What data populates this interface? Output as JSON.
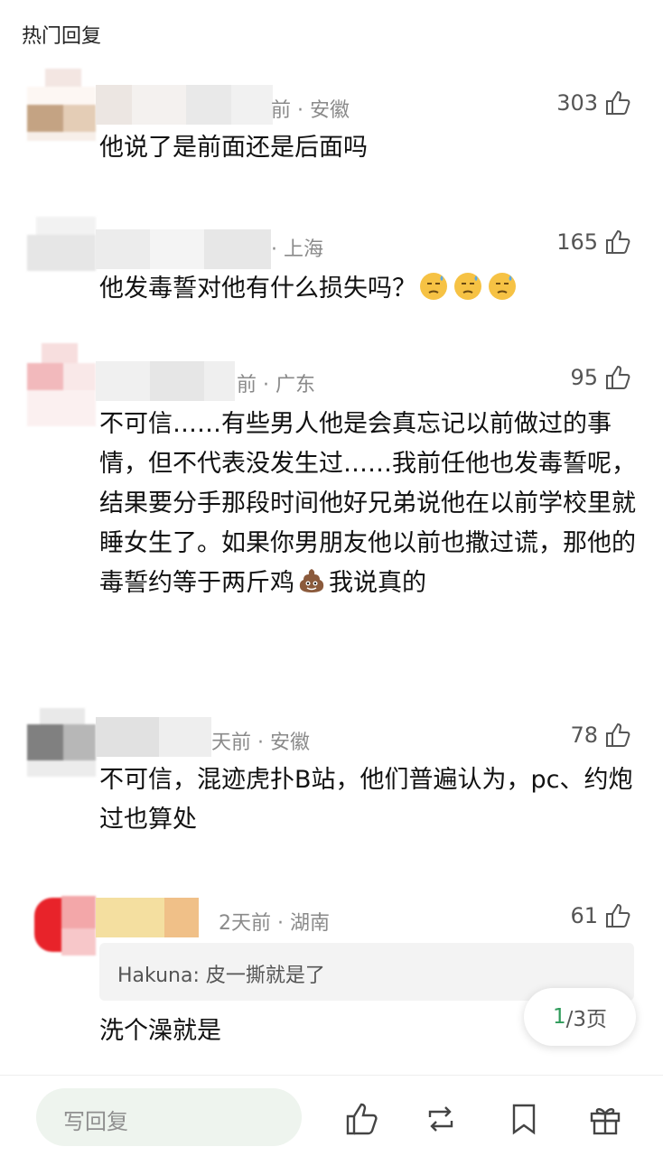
{
  "header": {
    "title": "热门回复"
  },
  "colors": {
    "accent": "#2e9b5a",
    "meta": "#8a8a8a"
  },
  "comments": [
    {
      "meta": "前 · 安徽",
      "likes": "303",
      "text": "他说了是前面还是后面吗"
    },
    {
      "meta": "· 上海",
      "likes": "165",
      "text": "他发毒誓对他有什么损失吗？"
    },
    {
      "meta": "前 · 广东",
      "likes": "95",
      "text": "不可信……有些男人他是会真忘记以前做过的事情，但不代表没发生过……我前任他也发毒誓呢，结果要分手那段时间他好兄弟说他在以前学校里就睡女生了。如果你男朋友他以前也撒过谎，那他的毒誓约等于两斤鸡",
      "text_tail": "我说真的"
    },
    {
      "meta": "天前 · 安徽",
      "likes": "78",
      "text": "不可信，混迹虎扑B站，他们普遍认为，pc、约炮过也算处"
    },
    {
      "meta": "2天前 · 湖南",
      "likes": "61",
      "quote": "Hakuna: 皮一撕就是了",
      "text": "洗个澡就是"
    }
  ],
  "pager": {
    "current": "1",
    "total": "/3页"
  },
  "bottom_bar": {
    "reply_placeholder": "写回复",
    "icons": [
      "like-icon",
      "repost-icon",
      "bookmark-icon",
      "gift-icon"
    ]
  }
}
